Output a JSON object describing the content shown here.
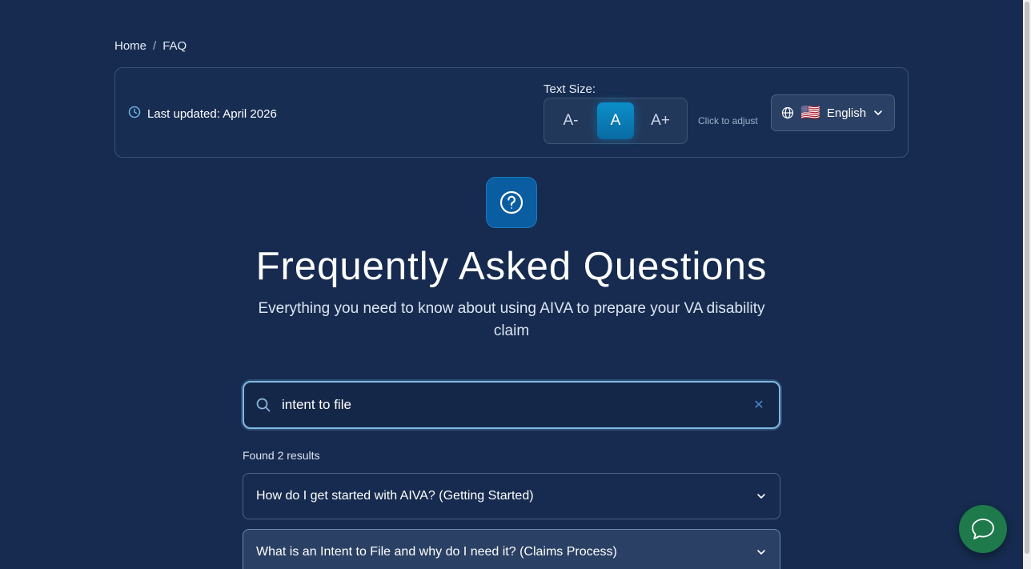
{
  "breadcrumb": {
    "home": "Home",
    "separator": "/",
    "current": "FAQ"
  },
  "toolbar": {
    "last_updated": "Last updated: April 2026",
    "text_size_label": "Text Size:",
    "size_decrease": "A-",
    "size_normal": "A",
    "size_increase": "A+",
    "adjust_hint": "Click to adjust",
    "language": {
      "flag": "🇺🇸",
      "label": "English"
    }
  },
  "hero": {
    "icon": "question-circle-icon",
    "title": "Frequently Asked Questions",
    "subtitle": "Everything you need to know about using AIVA to prepare your VA disability claim"
  },
  "search": {
    "value": "intent to file",
    "clear_label": "✕"
  },
  "results": {
    "count_text": "Found 2 results",
    "items": [
      {
        "question": "How do I get started with AIVA? (Getting Started)"
      },
      {
        "question": "What is an Intent to File and why do I need it? (Claims Process)"
      }
    ]
  },
  "colors": {
    "background": "#162b4f",
    "accent": "#0b8fc9",
    "chat_button": "#1e7a4a"
  }
}
